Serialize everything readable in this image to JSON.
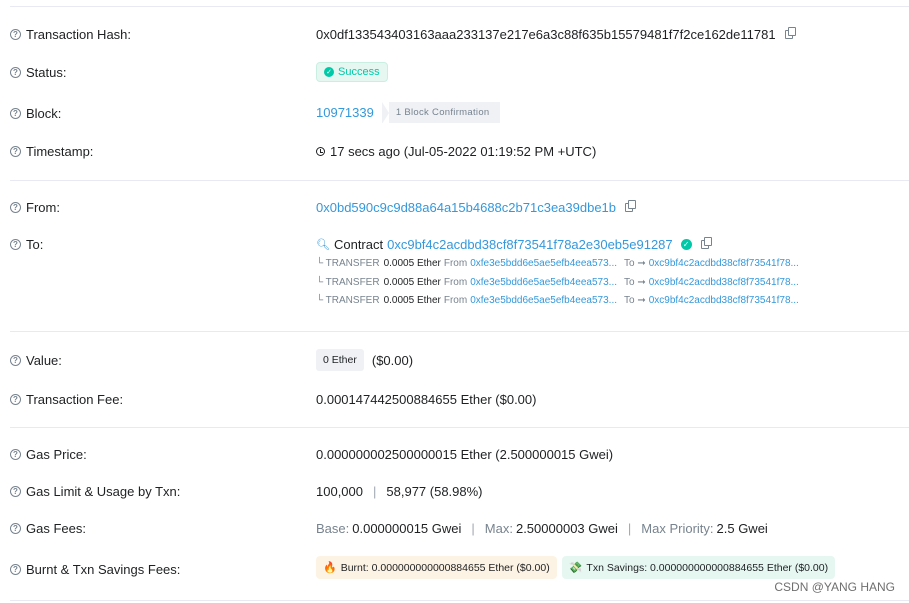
{
  "rows": {
    "tx_hash": {
      "label": "Transaction Hash:",
      "value": "0x0df133543403163aaa233137e217e6a3c88f635b15579481f7f2ce162de11781"
    },
    "status": {
      "label": "Status:",
      "value": "Success"
    },
    "block": {
      "label": "Block:",
      "value": "10971339",
      "confirmations": "1 Block Confirmation"
    },
    "timestamp": {
      "label": "Timestamp:",
      "value": "17 secs ago (Jul-05-2022 01:19:52 PM +UTC)"
    },
    "from": {
      "label": "From:",
      "value": "0x0bd590c9c9d88a64a15b4688c2b71c3ea39dbe1b"
    },
    "to": {
      "label": "To:",
      "prefix": "Contract",
      "value": "0xc9bf4c2acdbd38cf8f73541f78a2e30eb5e91287",
      "transfers": [
        {
          "kind": "└ TRANSFER",
          "amount": "0.0005 Ether",
          "from_label": "From",
          "from": "0xfe3e5bdd6e5ae5efb4eea573...",
          "to_label": "To ➞",
          "to": "0xc9bf4c2acdbd38cf8f73541f78..."
        },
        {
          "kind": "└ TRANSFER",
          "amount": "0.0005 Ether",
          "from_label": "From",
          "from": "0xfe3e5bdd6e5ae5efb4eea573...",
          "to_label": "To ➞",
          "to": "0xc9bf4c2acdbd38cf8f73541f78..."
        },
        {
          "kind": "└ TRANSFER",
          "amount": "0.0005 Ether",
          "from_label": "From",
          "from": "0xfe3e5bdd6e5ae5efb4eea573...",
          "to_label": "To ➞",
          "to": "0xc9bf4c2acdbd38cf8f73541f78..."
        }
      ]
    },
    "value": {
      "label": "Value:",
      "amount": "0 Ether",
      "usd": "($0.00)"
    },
    "tx_fee": {
      "label": "Transaction Fee:",
      "value": "0.000147442500884655 Ether ($0.00)"
    },
    "gas_price": {
      "label": "Gas Price:",
      "value": "0.000000002500000015 Ether (2.500000015 Gwei)"
    },
    "gas_limit": {
      "label": "Gas Limit & Usage by Txn:",
      "limit": "100,000",
      "sep": "|",
      "usage": "58,977 (58.98%)"
    },
    "gas_fees": {
      "label": "Gas Fees:",
      "base_label": "Base:",
      "base": "0.000000015 Gwei",
      "max_label": "Max:",
      "max": "2.50000003 Gwei",
      "prio_label": "Max Priority:",
      "prio": "2.5 Gwei",
      "sep": "|"
    },
    "burnt": {
      "label": "Burnt & Txn Savings Fees:",
      "burnt": "Burnt: 0.000000000000884655 Ether ($0.00)",
      "savings": "Txn Savings: 0.000000000000884655 Ether ($0.00)"
    }
  },
  "watermark": "CSDN @YANG HANG",
  "colors": {
    "link": "#3498db",
    "success": "#00c9a7",
    "muted": "#77838f"
  }
}
